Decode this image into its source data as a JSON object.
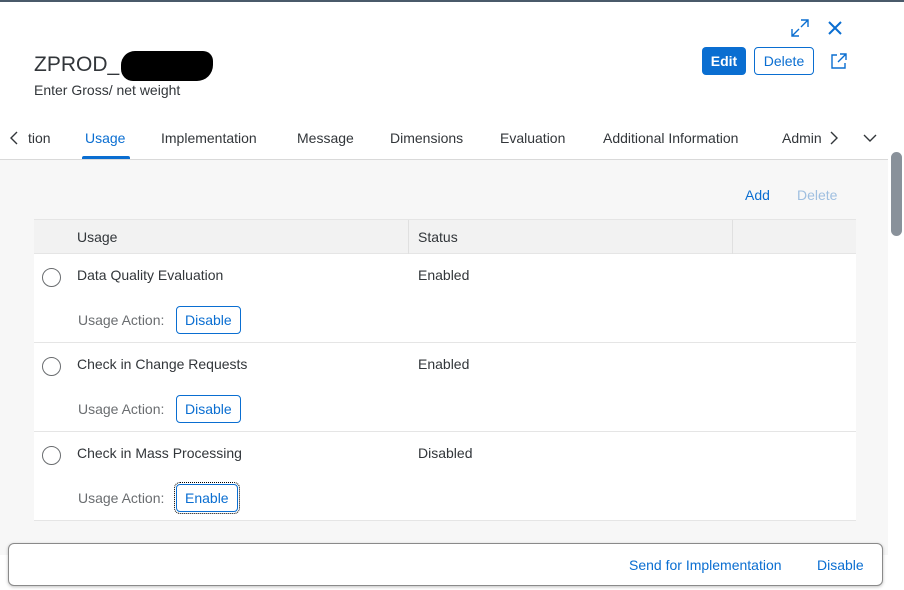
{
  "header": {
    "title": "ZPROD_",
    "subtitle": "Enter Gross/ net weight",
    "edit_label": "Edit",
    "delete_label": "Delete",
    "icons": [
      "expand-icon",
      "close-icon",
      "share-icon"
    ]
  },
  "tabs": {
    "partial_left": "tion",
    "items": [
      "Usage",
      "Implementation",
      "Message",
      "Dimensions",
      "Evaluation",
      "Additional Information"
    ],
    "partial_right": "Admin",
    "active": "Usage"
  },
  "toolbar": {
    "add_label": "Add",
    "delete_label": "Delete"
  },
  "table": {
    "columns": [
      "Usage",
      "Status"
    ],
    "action_label": "Usage Action:",
    "rows": [
      {
        "usage": "Data Quality Evaluation",
        "status": "Enabled",
        "action": "Disable"
      },
      {
        "usage": "Check in Change Requests",
        "status": "Enabled",
        "action": "Disable"
      },
      {
        "usage": "Check in Mass Processing",
        "status": "Disabled",
        "action": "Enable"
      }
    ]
  },
  "footer": {
    "send_label": "Send for Implementation",
    "disable_label": "Disable"
  },
  "colors": {
    "accent": "#0a6ed1",
    "text": "#32363a",
    "background": "#f7f7f7"
  }
}
